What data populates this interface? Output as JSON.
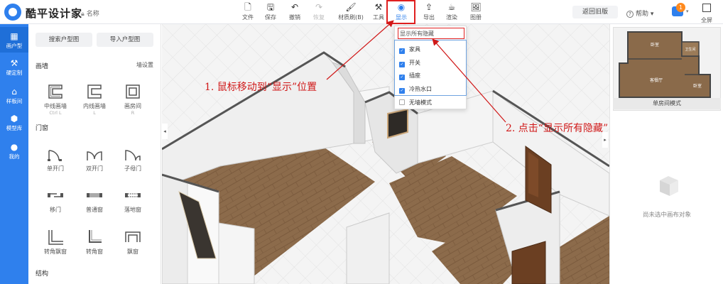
{
  "app": {
    "brand": "酷平设计家",
    "project_name": "名称"
  },
  "toolbar": {
    "tools": [
      {
        "label": "文件",
        "icon": "file-icon"
      },
      {
        "label": "保存",
        "icon": "save-icon"
      },
      {
        "label": "撤销",
        "icon": "undo-icon"
      },
      {
        "label": "恢复",
        "icon": "redo-icon"
      },
      {
        "label": "材质刷(B)",
        "icon": "brush-icon"
      },
      {
        "label": "工具",
        "icon": "tools-icon"
      },
      {
        "label": "显示",
        "icon": "eye-icon"
      },
      {
        "label": "导出",
        "icon": "export-icon"
      },
      {
        "label": "渲染",
        "icon": "render-icon"
      },
      {
        "label": "图册",
        "icon": "album-icon"
      }
    ],
    "old_version": "返回旧版",
    "help": "帮助",
    "notify_count": "1",
    "fullscreen": "全屏"
  },
  "leftnav": [
    {
      "label": "画户型",
      "icon": "floorplan-icon"
    },
    {
      "label": "硬定制",
      "icon": "custom-icon"
    },
    {
      "label": "样板间",
      "icon": "house-icon"
    },
    {
      "label": "模型库",
      "icon": "cube-icon"
    },
    {
      "label": "我的",
      "icon": "user-icon"
    }
  ],
  "panel": {
    "search_btn": "搜索户型图",
    "import_btn": "导入户型图",
    "wall_section": "画墙",
    "wall_settings": "墙设置",
    "walls": [
      {
        "label": "中线画墙",
        "key": "Ctrl L"
      },
      {
        "label": "内线画墙",
        "key": "L"
      },
      {
        "label": "画房间",
        "key": "R"
      }
    ],
    "door_section": "门窗",
    "doors_row1": [
      {
        "label": "单开门"
      },
      {
        "label": "双开门"
      },
      {
        "label": "子母门"
      }
    ],
    "doors_row2": [
      {
        "label": "移门"
      },
      {
        "label": "普通窗"
      },
      {
        "label": "落地窗"
      }
    ],
    "doors_row3": [
      {
        "label": "转角飘窗"
      },
      {
        "label": "转角窗"
      },
      {
        "label": "飘窗"
      }
    ],
    "struct_section": "结构"
  },
  "dropdown": {
    "show_all": "显示所有隐藏",
    "options": [
      {
        "label": "家具",
        "checked": true
      },
      {
        "label": "开关",
        "checked": true
      },
      {
        "label": "插座",
        "checked": true
      },
      {
        "label": "冷热水口",
        "checked": true
      },
      {
        "label": "无墙模式",
        "checked": false
      }
    ]
  },
  "annotations": {
    "step1": "1. 鼠标移动到“显示”位置",
    "step2": "2. 点击“显示所有隐藏”"
  },
  "rpanel": {
    "minimap_label": "单房间模式",
    "rooms": [
      "卧室",
      "卫生间",
      "客餐厅",
      "卧室"
    ],
    "empty_text": "尚未选中画布对象"
  },
  "colors": {
    "accent": "#2f80ed",
    "annotation": "#d01818",
    "floor": "#8a6a4a",
    "door": "#6b3f22"
  }
}
